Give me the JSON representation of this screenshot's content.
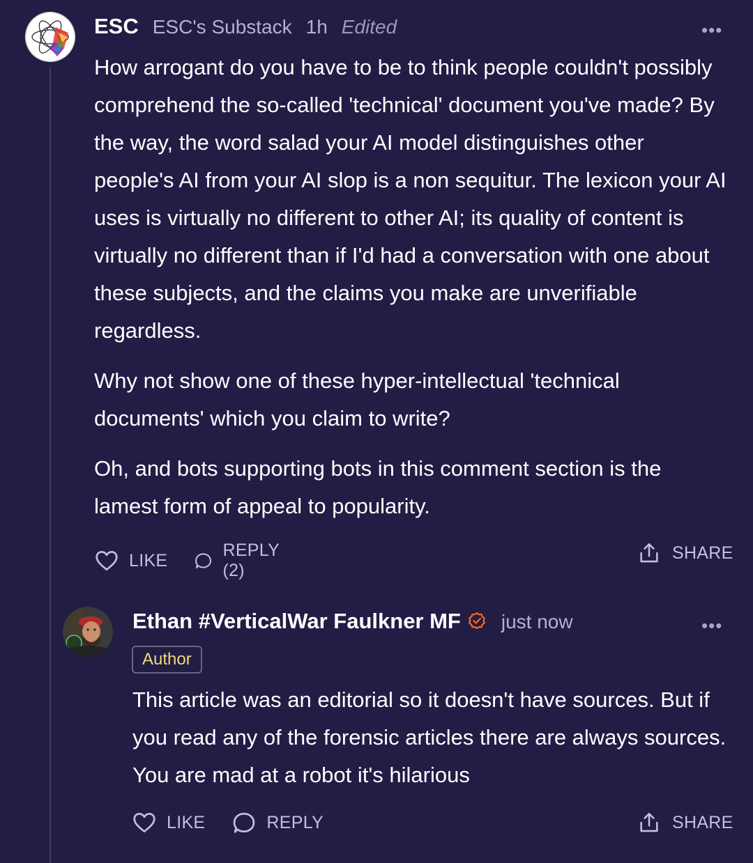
{
  "colors": {
    "background": "#211d45",
    "text": "#ffffff",
    "muted": "#b5b2cc",
    "badge_text": "#f3d97a",
    "verified": "#ff6719"
  },
  "comments": [
    {
      "author": "ESC",
      "publication": "ESC's Substack",
      "time": "1h",
      "edited": "Edited",
      "more": "•••",
      "paragraphs": [
        "How arrogant do you have to be to think people couldn't possibly comprehend the so-called 'technical' document you've made? By the way, the word salad your AI model distinguishes other people's AI from your AI slop is a non sequitur. The lexicon your AI uses is virtually no different to other AI; its quality of content is virtually no different than if I'd had a conversation with one about these subjects, and the claims you make are unverifiable regardless.",
        "Why not show one of these hyper-intellectual 'technical documents' which you claim to write?",
        "Oh, and bots supporting bots in this comment section is the lamest form of appeal to popularity."
      ],
      "like": "LIKE",
      "reply": "REPLY (2)",
      "share": "SHARE"
    },
    {
      "author": "Ethan #VerticalWar Faulkner MF",
      "time": "just now",
      "badge": "Author",
      "more": "•••",
      "paragraphs": [
        "This article was an editorial so it doesn't have sources. But if you read any of the forensic articles there are always sources. You are mad at a robot it's hilarious"
      ],
      "like": "LIKE",
      "reply": "REPLY",
      "share": "SHARE"
    }
  ]
}
